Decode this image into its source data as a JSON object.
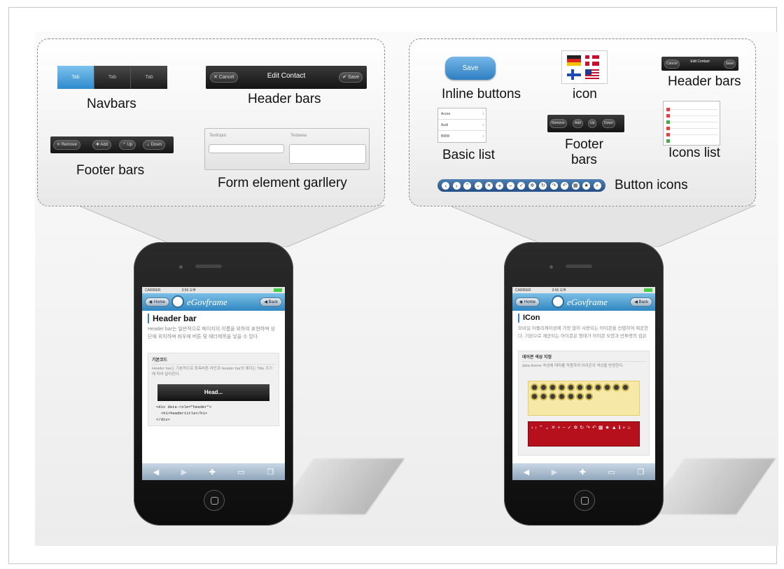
{
  "left_panel": {
    "navbar_tabs": [
      "Tab",
      "Tab",
      "Tab"
    ],
    "navbars_label": "Navbars",
    "header_bars_label": "Header bars",
    "header_bar": {
      "cancel": "Cancel",
      "title": "Edit Contact",
      "save": "Save"
    },
    "footer_bars_label": "Footer bars",
    "footer_bar": [
      "Remove",
      "Add",
      "Up",
      "Down"
    ],
    "form_gallery_label": "Form element garllery",
    "form_fields": [
      "Textinput",
      "Textarea"
    ]
  },
  "right_panel": {
    "save_button": "Save",
    "inline_buttons_label": "Inline buttons",
    "icon_label": "icon",
    "header_bars_label": "Header bars",
    "mini_header": {
      "left": "Cancel",
      "title": "Edit Contact",
      "right": "Save"
    },
    "basic_list_label": "Basic list",
    "basic_list": [
      "Acura",
      "Audi",
      "BMW"
    ],
    "footer_bars_label": "Footer\nbars",
    "mini_footer": [
      "Remove",
      "Add",
      "Up",
      "Down"
    ],
    "icons_list_label": "Icons list",
    "button_icons_label": "Button icons"
  },
  "phone_left": {
    "carrier": "CARRIER",
    "time": "3:56 오후",
    "home": "Home",
    "brand": "eGovframe",
    "back": "Back",
    "heading": "Header bar",
    "desc": "Header bar는 일반적으로 페이지의 이름을 위하여 표현하며 상단에 위치하며 좌우에 버튼 및 헤더제목을 넣을 수 있다.",
    "code_title": "기본코드",
    "code_desc": "Header bar는 기본적으로 좌측버튼 라인과 Header bar의 헤더는 Title 크기에 따라 달라진다.",
    "demo_header": "Head...",
    "code_lines": [
      "<div data-role=\"header\">",
      "<h1>headertitle</h1>",
      "</div>"
    ]
  },
  "phone_right": {
    "carrier": "CARRIER",
    "time": "3:56 오후",
    "home": "Home",
    "brand": "eGovframe",
    "back": "Back",
    "heading": "ICon",
    "desc": "모바일 어플리케이션에 가장 많이 사용되는 아이콘을 선별하여 제공한다. 기본으로 제공되는 아이콘은 형태가 아이콘 모양과 반투명의 검은",
    "section_title": "데이콘 색상 지정",
    "section_desc": "data-theme 속성에 테마를 적용하여 아이콘의 색상을 변경한다."
  }
}
